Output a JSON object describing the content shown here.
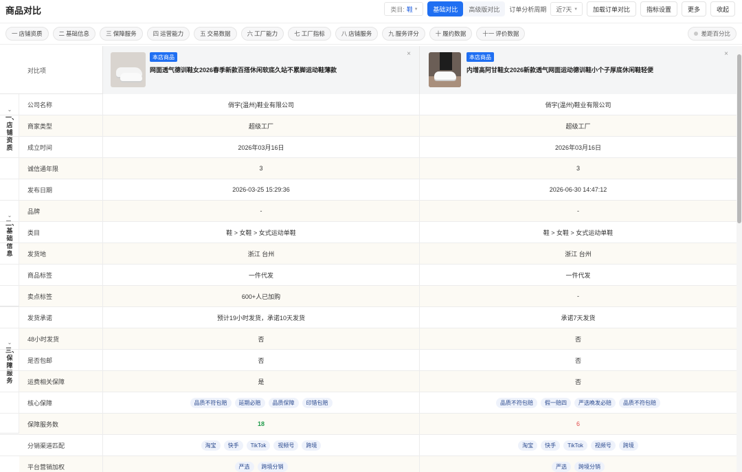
{
  "header": {
    "title": "商品对比",
    "category_label": "类目:",
    "category_value": "鞋",
    "category_arrow": "▾",
    "mode_basic": "基础对比",
    "mode_advanced": "高级版对比",
    "period_label": "订单分析周期",
    "period_value": "近7天",
    "period_arrow": "▾",
    "btn_load": "加载订单对比",
    "btn_metrics": "指标设置",
    "btn_more": "更多",
    "btn_collapse": "收起"
  },
  "chips": [
    {
      "icon": "一",
      "label": "店铺资质"
    },
    {
      "icon": "二",
      "label": "基础信息"
    },
    {
      "icon": "三",
      "label": "保障服务"
    },
    {
      "icon": "四",
      "label": "运营能力"
    },
    {
      "icon": "五",
      "label": "交易数据"
    },
    {
      "icon": "六",
      "label": "工厂能力"
    },
    {
      "icon": "七",
      "label": "工厂指标"
    },
    {
      "icon": "八",
      "label": "店铺服务"
    },
    {
      "icon": "九",
      "label": "服务评分"
    },
    {
      "icon": "十",
      "label": "履约数据"
    },
    {
      "icon": "十一",
      "label": "评价数据"
    }
  ],
  "diff_toggle": "差距百分比",
  "compare_label": "对比项",
  "products": [
    {
      "badge": "本店商品",
      "name": "网面透气德训鞋女2026春季新款百搭休闲软底久站不累脚运动鞋薄款",
      "close": "×"
    },
    {
      "badge": "本店商品",
      "name": "内增高阿甘鞋女2026新款透气网面运动德训鞋小个子厚底休闲鞋轻便",
      "close": "×"
    }
  ],
  "sections": {
    "s1": "一、店铺资质",
    "s2": "二、基础信息",
    "s3": "三、保障服务",
    "chev": "⌄"
  },
  "rows": {
    "r0": {
      "label": "公司名称",
      "a": "俏宇(温州)鞋业有限公司",
      "b": "俏宇(温州)鞋业有限公司"
    },
    "r1": {
      "label": "商家类型",
      "a": "超级工厂",
      "b": "超级工厂"
    },
    "r2": {
      "label": "成立时间",
      "a": "2026年03月16日",
      "b": "2026年03月16日"
    },
    "r3": {
      "label": "诚信通年限",
      "a": "3",
      "b": "3"
    },
    "r4": {
      "label": "发布日期",
      "a": "2026-03-25 15:29:36",
      "b": "2026-06-30 14:47:12"
    },
    "r5": {
      "label": "品牌",
      "a": "-",
      "b": "-"
    },
    "r6": {
      "label": "类目",
      "a": "鞋 > 女鞋 > 女式运动单鞋",
      "b": "鞋 > 女鞋 > 女式运动单鞋"
    },
    "r7": {
      "label": "发货地",
      "a": "浙江 台州",
      "b": "浙江 台州"
    },
    "r8": {
      "label": "商品标签",
      "a": "一件代发",
      "b": "一件代发"
    },
    "r9": {
      "label": "卖点标签",
      "a": "600+人已加购",
      "b": "-"
    },
    "r10": {
      "label": "发货承诺",
      "a": "预计19小时发货，承诺10天发货",
      "b": "承诺7天发货"
    },
    "r11": {
      "label": "48小时发货",
      "a": "否",
      "b": "否"
    },
    "r12": {
      "label": "是否包邮",
      "a": "否",
      "b": "否"
    },
    "r13": {
      "label": "运费相关保障",
      "a": "是",
      "b": "否"
    },
    "r14": {
      "label": "核心保障",
      "a": [
        "品质不符包赔",
        "延期必赔",
        "品质保障",
        "印错包赔"
      ],
      "b": [
        "品质不符包赔",
        "假一赔四",
        "严选晚发必赔",
        "品质不符包赔"
      ]
    },
    "r15": {
      "label": "保障服务数",
      "a": "18",
      "b": "6"
    },
    "r16": {
      "label": "分销渠道匹配",
      "a": [
        "淘宝",
        "快手",
        "TikTok",
        "视频号",
        "跨境"
      ],
      "b": [
        "淘宝",
        "快手",
        "TikTok",
        "视频号",
        "跨境"
      ]
    },
    "r17": {
      "label": "平台营销加权",
      "a": [
        "严选",
        "跨境分销"
      ],
      "b": [
        "严选",
        "跨境分销"
      ]
    }
  }
}
